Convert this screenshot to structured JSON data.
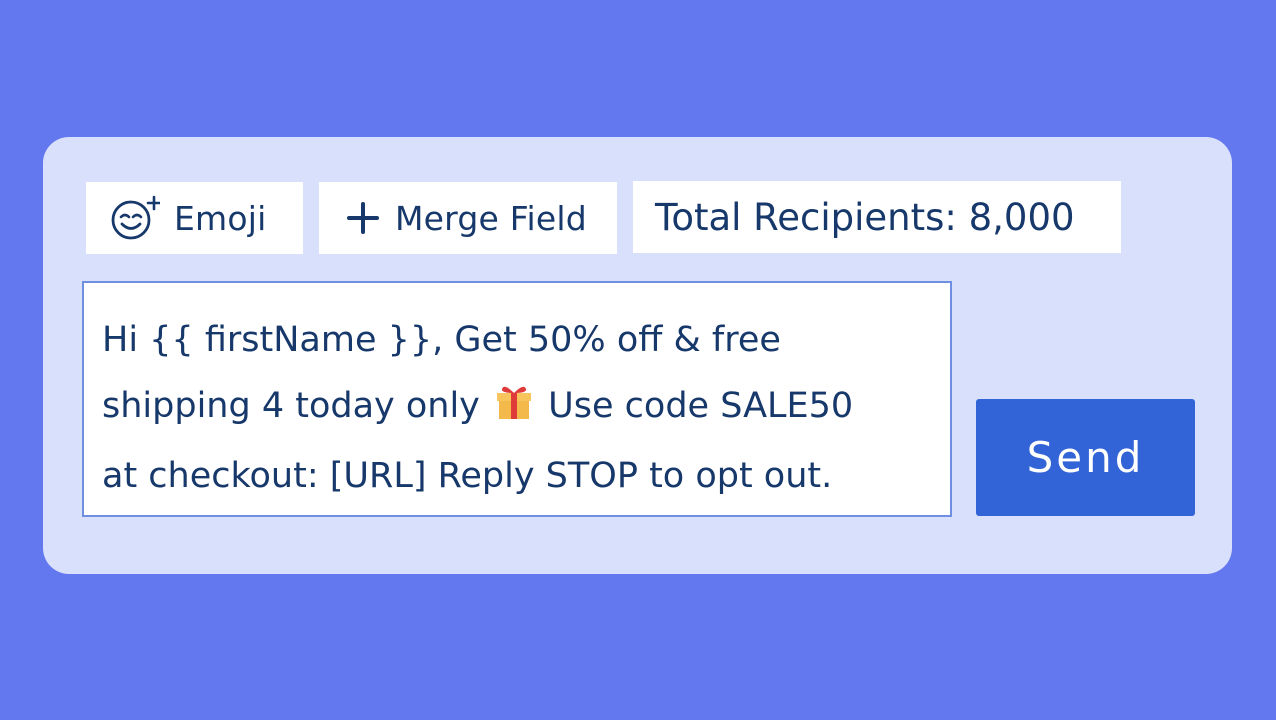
{
  "toolbar": {
    "emoji": {
      "label": "Emoji",
      "icon": "smile-plus-icon"
    },
    "merge_field": {
      "label": "Merge Field",
      "icon": "plus-icon"
    },
    "recipients": {
      "label": "Total Recipients: 8,000"
    }
  },
  "message": {
    "line1": "Hi {{ firstName }}, Get 50% off & free",
    "line2_before": "shipping 4 today only",
    "line2_after": "Use code SALE50",
    "line3": "at checkout: [URL] Reply STOP to opt out.",
    "emoji_icon": "gift-icon"
  },
  "send": {
    "label": "Send"
  },
  "colors": {
    "background": "#6377ee",
    "panel": "#d8e0fb",
    "text": "#17386a",
    "send_button": "#3263d7",
    "input_border": "#6f8fe0"
  }
}
